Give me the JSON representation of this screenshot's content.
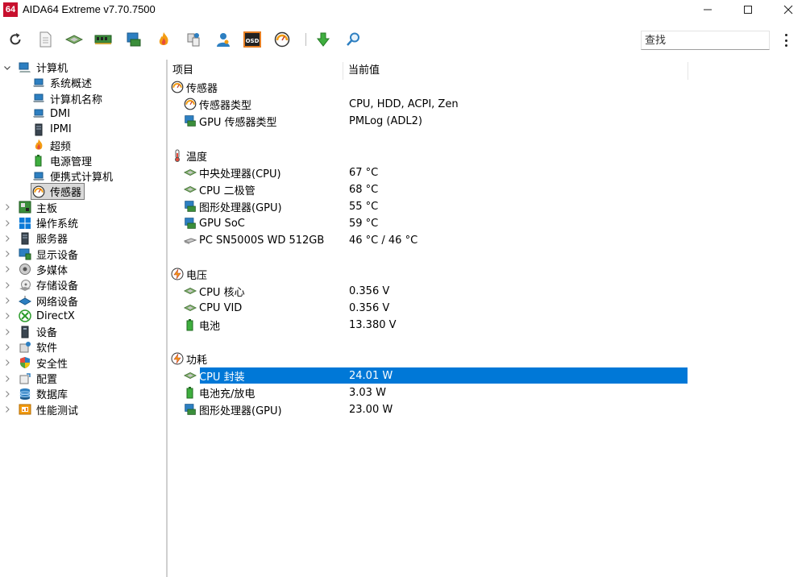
{
  "window": {
    "logo_text": "64",
    "title": "AIDA64 Extreme v7.70.7500"
  },
  "toolbar": {
    "search_placeholder": "查找"
  },
  "tree": {
    "items": [
      {
        "label": "计算机",
        "level": 0,
        "expander": "down"
      },
      {
        "label": "系统概述",
        "level": 1
      },
      {
        "label": "计算机名称",
        "level": 1
      },
      {
        "label": "DMI",
        "level": 1
      },
      {
        "label": "IPMI",
        "level": 1
      },
      {
        "label": "超频",
        "level": 1
      },
      {
        "label": "电源管理",
        "level": 1
      },
      {
        "label": "便携式计算机",
        "level": 1
      },
      {
        "label": "传感器",
        "level": 1,
        "selected": true
      },
      {
        "label": "主板",
        "level": 0,
        "expander": "right"
      },
      {
        "label": "操作系统",
        "level": 0,
        "expander": "right"
      },
      {
        "label": "服务器",
        "level": 0,
        "expander": "right"
      },
      {
        "label": "显示设备",
        "level": 0,
        "expander": "right"
      },
      {
        "label": "多媒体",
        "level": 0,
        "expander": "right"
      },
      {
        "label": "存储设备",
        "level": 0,
        "expander": "right"
      },
      {
        "label": "网络设备",
        "level": 0,
        "expander": "right"
      },
      {
        "label": "DirectX",
        "level": 0,
        "expander": "right"
      },
      {
        "label": "设备",
        "level": 0,
        "expander": "right"
      },
      {
        "label": "软件",
        "level": 0,
        "expander": "right"
      },
      {
        "label": "安全性",
        "level": 0,
        "expander": "right"
      },
      {
        "label": "配置",
        "level": 0,
        "expander": "right"
      },
      {
        "label": "数据库",
        "level": 0,
        "expander": "right"
      },
      {
        "label": "性能测试",
        "level": 0,
        "expander": "right"
      }
    ]
  },
  "table": {
    "col_item": "项目",
    "col_value": "当前值",
    "groups": [
      {
        "title": "传感器",
        "rows": [
          {
            "name": "传感器类型",
            "value": "CPU, HDD, ACPI, Zen"
          },
          {
            "name": "GPU 传感器类型",
            "value": "PMLog  (ADL2)"
          }
        ]
      },
      {
        "title": "温度",
        "rows": [
          {
            "name": "中央处理器(CPU)",
            "value": "67 °C"
          },
          {
            "name": "CPU 二极管",
            "value": "68 °C"
          },
          {
            "name": "图形处理器(GPU)",
            "value": "55 °C"
          },
          {
            "name": "GPU SoC",
            "value": "59 °C"
          },
          {
            "name": "PC SN5000S WD 512GB",
            "value": "46 °C / 46 °C"
          }
        ]
      },
      {
        "title": "电压",
        "rows": [
          {
            "name": "CPU 核心",
            "value": "0.356 V"
          },
          {
            "name": "CPU VID",
            "value": "0.356 V"
          },
          {
            "name": "电池",
            "value": "13.380 V"
          }
        ]
      },
      {
        "title": "功耗",
        "rows": [
          {
            "name": "CPU 封装",
            "value": "24.01 W",
            "selected": true
          },
          {
            "name": "电池充/放电",
            "value": "3.03 W"
          },
          {
            "name": "图形处理器(GPU)",
            "value": "23.00 W"
          }
        ]
      }
    ]
  },
  "colors": {
    "selection": "#0078d7",
    "logo": "#c8102e"
  }
}
